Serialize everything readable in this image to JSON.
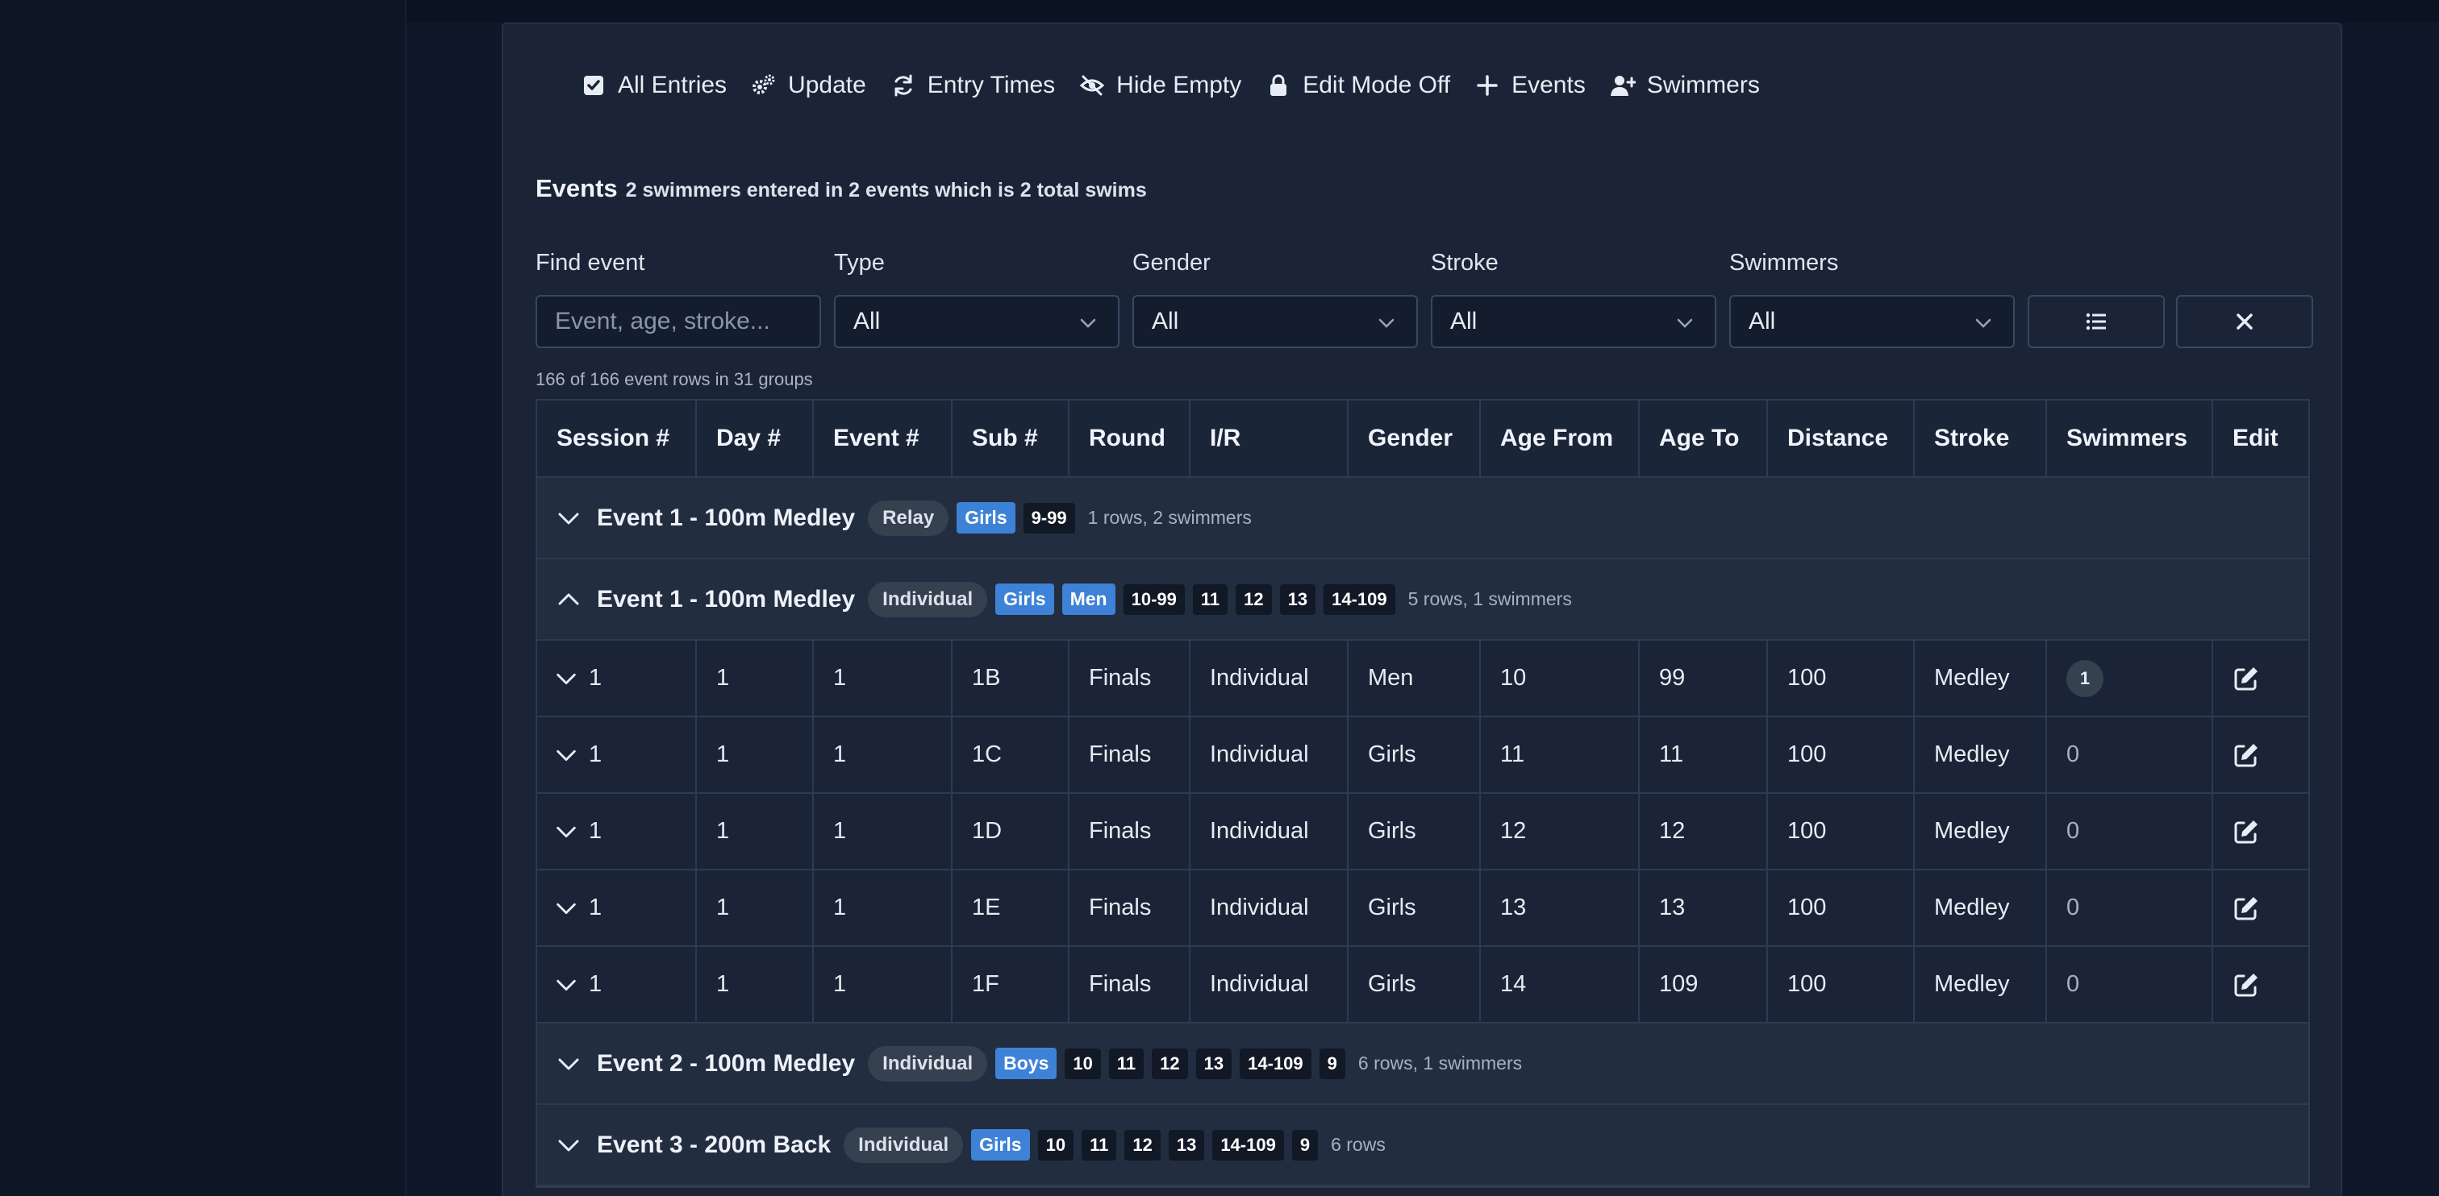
{
  "toolbar": {
    "all_entries": "All Entries",
    "update": "Update",
    "entry_times": "Entry Times",
    "hide_empty": "Hide Empty",
    "edit_mode": "Edit Mode Off",
    "events": "Events",
    "swimmers": "Swimmers"
  },
  "title": {
    "main": "Events",
    "sub": "2 swimmers entered in 2 events which is 2 total swims"
  },
  "filters": {
    "find_label": "Find event",
    "find_placeholder": "Event, age, stroke...",
    "type_label": "Type",
    "type_value": "All",
    "gender_label": "Gender",
    "gender_value": "All",
    "stroke_label": "Stroke",
    "stroke_value": "All",
    "swimmers_label": "Swimmers",
    "swimmers_value": "All"
  },
  "count_text": "166 of 166 event rows in 31 groups",
  "table": {
    "headers": [
      "Session #",
      "Day #",
      "Event #",
      "Sub #",
      "Round",
      "I/R",
      "Gender",
      "Age From",
      "Age To",
      "Distance",
      "Stroke",
      "Swimmers",
      "Edit"
    ],
    "groups": [
      {
        "title": "Event 1 - 100m Medley",
        "type": "Relay",
        "genders": [
          "Girls"
        ],
        "ages": [
          "9-99"
        ],
        "meta": "1 rows, 2 swimmers",
        "expanded": false
      },
      {
        "title": "Event 1 - 100m Medley",
        "type": "Individual",
        "genders": [
          "Girls",
          "Men"
        ],
        "ages": [
          "10-99",
          "11",
          "12",
          "13",
          "14-109"
        ],
        "meta": "5 rows, 1 swimmers",
        "expanded": true
      },
      {
        "title": "Event 2 - 100m Medley",
        "type": "Individual",
        "genders": [
          "Boys"
        ],
        "ages": [
          "10",
          "11",
          "12",
          "13",
          "14-109",
          "9"
        ],
        "meta": "6 rows, 1 swimmers",
        "expanded": false
      },
      {
        "title": "Event 3 - 200m Back",
        "type": "Individual",
        "genders": [
          "Girls"
        ],
        "ages": [
          "10",
          "11",
          "12",
          "13",
          "14-109",
          "9"
        ],
        "meta": "6 rows",
        "expanded": false
      }
    ],
    "rows": [
      {
        "session": "1",
        "day": "1",
        "event": "1",
        "sub": "1B",
        "round": "Finals",
        "ir": "Individual",
        "gender": "Men",
        "age_from": "10",
        "age_to": "99",
        "distance": "100",
        "stroke": "Medley",
        "swimmers": "1"
      },
      {
        "session": "1",
        "day": "1",
        "event": "1",
        "sub": "1C",
        "round": "Finals",
        "ir": "Individual",
        "gender": "Girls",
        "age_from": "11",
        "age_to": "11",
        "distance": "100",
        "stroke": "Medley",
        "swimmers": "0"
      },
      {
        "session": "1",
        "day": "1",
        "event": "1",
        "sub": "1D",
        "round": "Finals",
        "ir": "Individual",
        "gender": "Girls",
        "age_from": "12",
        "age_to": "12",
        "distance": "100",
        "stroke": "Medley",
        "swimmers": "0"
      },
      {
        "session": "1",
        "day": "1",
        "event": "1",
        "sub": "1E",
        "round": "Finals",
        "ir": "Individual",
        "gender": "Girls",
        "age_from": "13",
        "age_to": "13",
        "distance": "100",
        "stroke": "Medley",
        "swimmers": "0"
      },
      {
        "session": "1",
        "day": "1",
        "event": "1",
        "sub": "1F",
        "round": "Finals",
        "ir": "Individual",
        "gender": "Girls",
        "age_from": "14",
        "age_to": "109",
        "distance": "100",
        "stroke": "Medley",
        "swimmers": "0"
      }
    ]
  },
  "colors": {
    "background": "#0f1728",
    "panel": "#1a2436",
    "accent_blue": "#3d82d6",
    "badge_dark": "#111826",
    "pill_gray": "#36414f"
  }
}
